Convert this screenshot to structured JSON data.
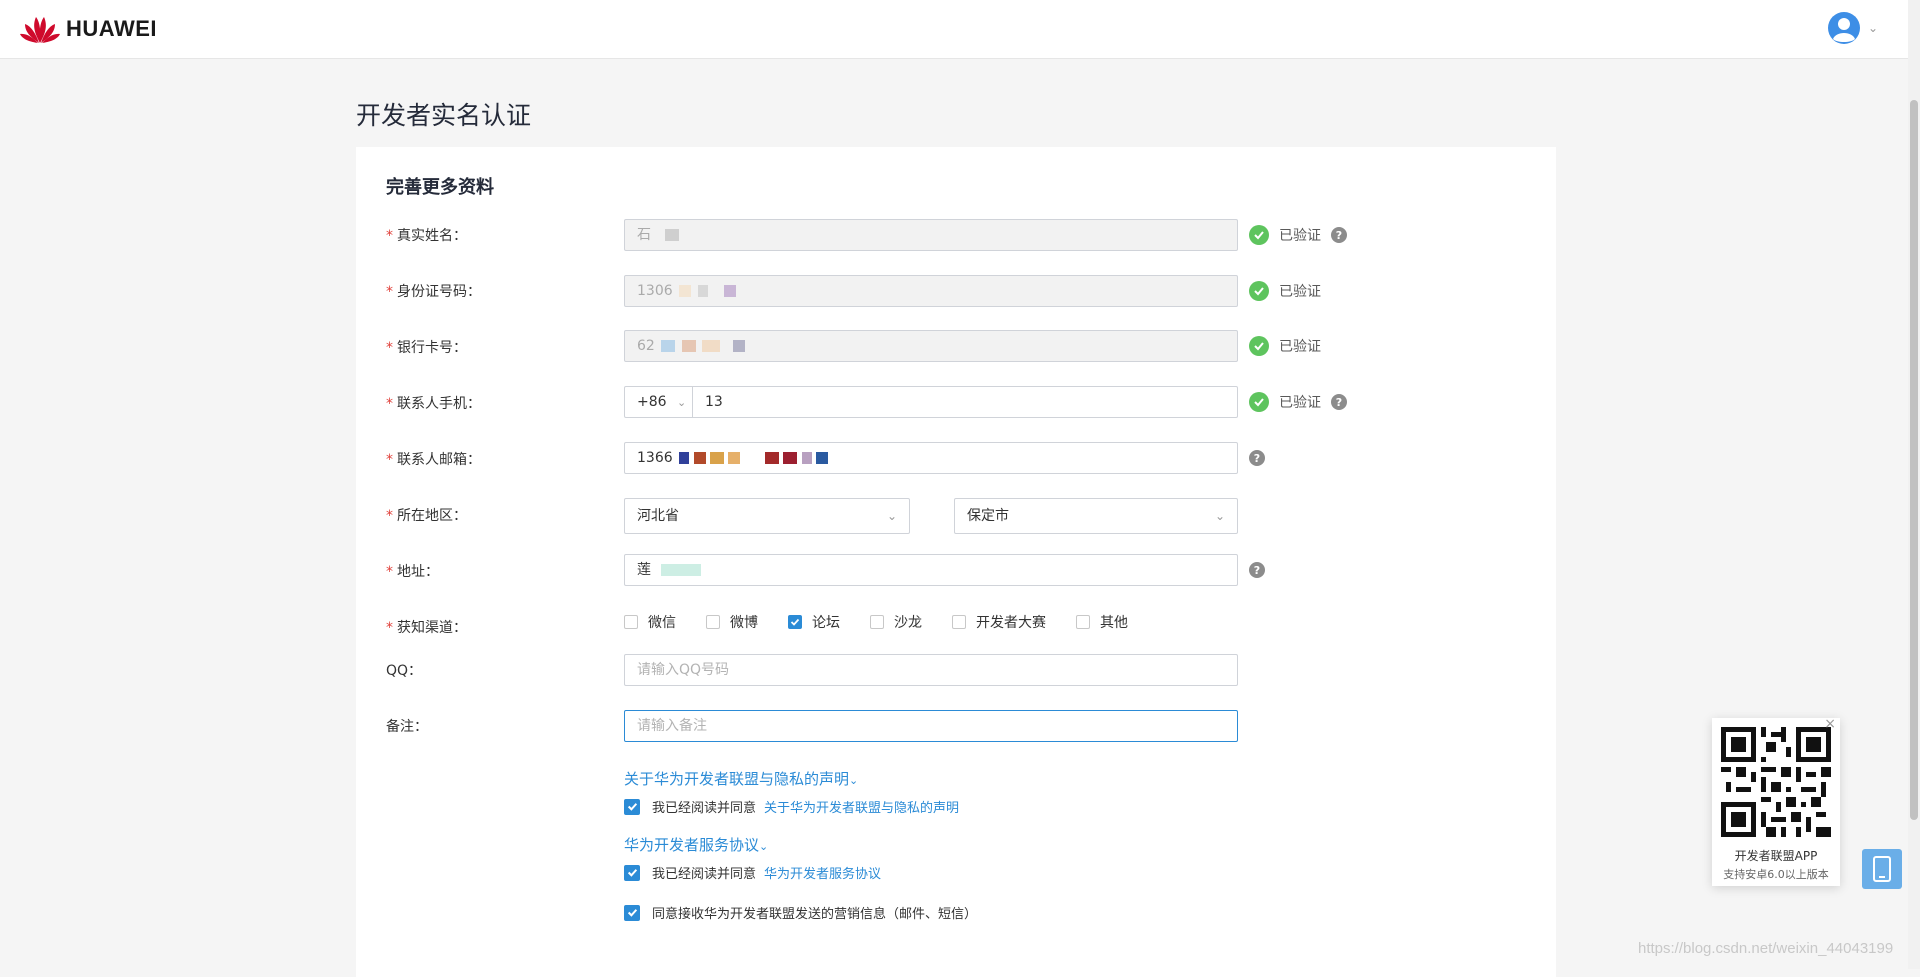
{
  "header": {
    "brand": "HUAWEI"
  },
  "page": {
    "title": "开发者实名认证",
    "section_title": "完善更多资料"
  },
  "form": {
    "required_mark": "*",
    "real_name": {
      "label": "真实姓名：",
      "value": "石",
      "status": "已验证"
    },
    "id_number": {
      "label": "身份证号码：",
      "value": "1306",
      "status": "已验证"
    },
    "bank_card": {
      "label": "银行卡号：",
      "value": "62",
      "status": "已验证"
    },
    "phone": {
      "label": "联系人手机：",
      "country_code": "+86",
      "value": "13",
      "status": "已验证"
    },
    "email": {
      "label": "联系人邮箱：",
      "value": "1366"
    },
    "region": {
      "label": "所在地区：",
      "province": "河北省",
      "city": "保定市"
    },
    "address": {
      "label": "地址：",
      "value": "莲"
    },
    "channel": {
      "label": "获知渠道：",
      "options": [
        {
          "label": "微信",
          "checked": false
        },
        {
          "label": "微博",
          "checked": false
        },
        {
          "label": "论坛",
          "checked": true
        },
        {
          "label": "沙龙",
          "checked": false
        },
        {
          "label": "开发者大赛",
          "checked": false
        },
        {
          "label": "其他",
          "checked": false
        }
      ]
    },
    "qq": {
      "label": "QQ：",
      "placeholder": "请输入QQ号码"
    },
    "remark": {
      "label": "备注：",
      "placeholder": "请输入备注"
    }
  },
  "agreements": {
    "privacy_head": "关于华为开发者联盟与隐私的声明",
    "privacy_text": "我已经阅读并同意",
    "privacy_link": "关于华为开发者联盟与隐私的声明",
    "service_head": "华为开发者服务协议",
    "service_text": "我已经阅读并同意",
    "service_link": "华为开发者服务协议",
    "marketing_text": "同意接收华为开发者联盟发送的营销信息（邮件、短信）"
  },
  "qr": {
    "title": "开发者联盟APP",
    "subtitle": "支持安卓6.0以上版本"
  },
  "watermark": "https://blog.csdn.net/weixin_44043199",
  "colors": {
    "accent": "#2b8bd6",
    "verified": "#5ec45e",
    "required": "#e0403a",
    "brand_red": "#cf0a2c"
  }
}
